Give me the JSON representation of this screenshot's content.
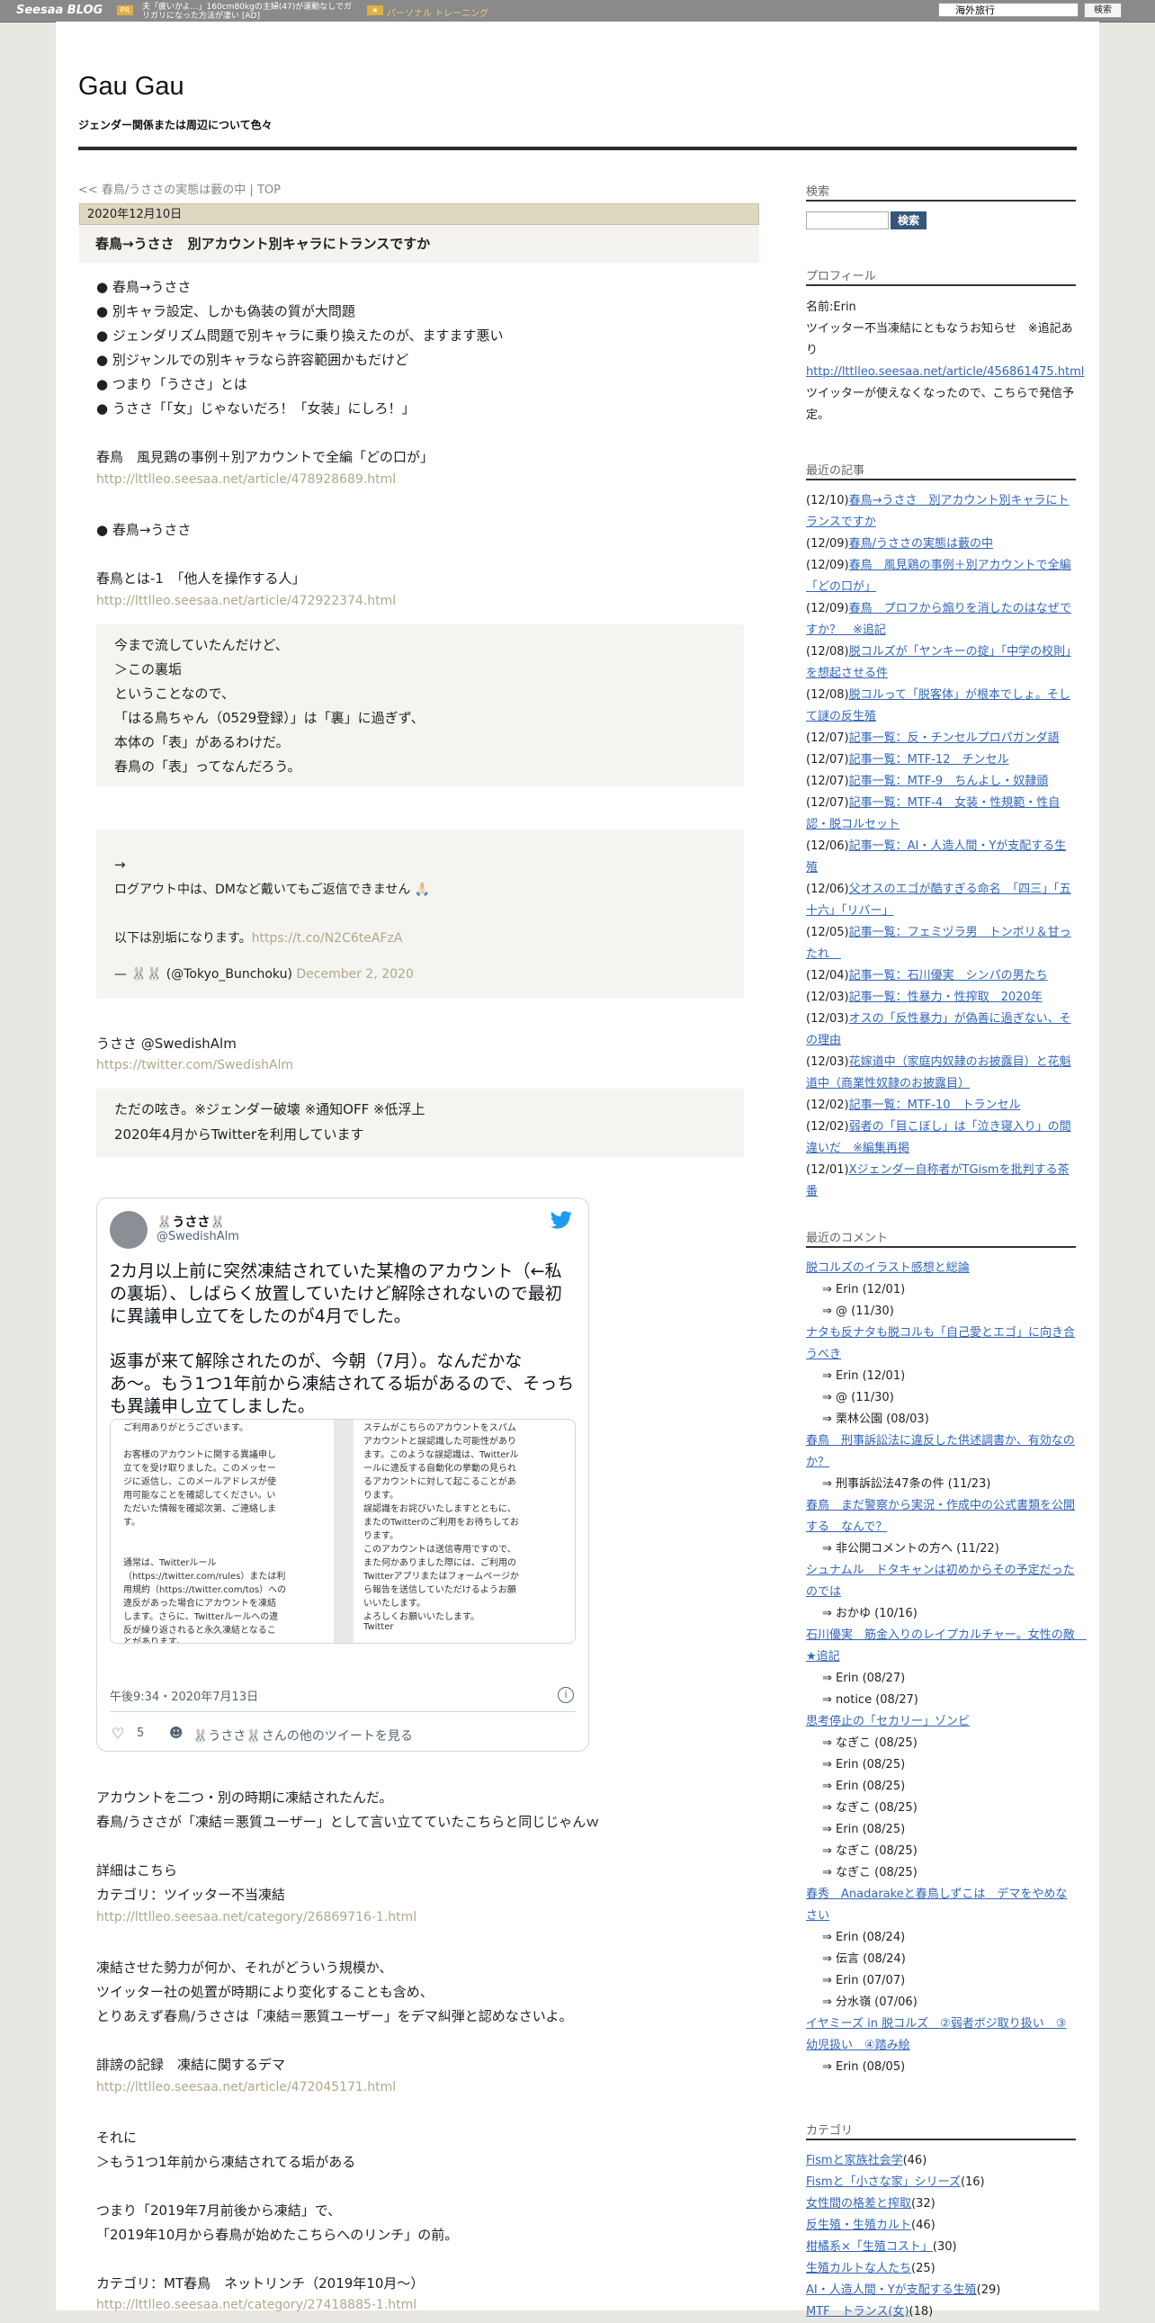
{
  "topbar": {
    "logo": "Seesaa BLOG",
    "ad_badge": "PR",
    "ad_text": "夫「疲いかよ…」160cm80kgの主婦(47)が運動なしでガリガリになった方法が凄い [AD]",
    "ad2_badge": "★",
    "ad2_text": "パーソナル トレーニング",
    "search_value": "海外旅行",
    "search_button": "検索"
  },
  "blog": {
    "title": "Gau Gau",
    "subtitle": "ジェンダー関係または周辺について色々"
  },
  "article": {
    "breadcrumb": "<< 春鳥/うささの実態は藪の中 | TOP",
    "date": "2020年12月10日",
    "title": "春鳥→うささ　別アカウント別キャラにトランスですか",
    "bullets": [
      "● 春鳥→うささ",
      "● 別キャラ設定、しかも偽装の質が大問題",
      "● ジェンダリズム問題で別キャラに乗り換えたのが、ますます悪い",
      "● 別ジャンルでの別キャラなら許容範囲かもだけど",
      "● つまり「うささ」とは",
      "● うささ「「女」じゃないだろ！「女装」にしろ！」"
    ],
    "p1": "春鳥　風見鶏の事例＋別アカウントで全編「どの口が」",
    "link1": "http://lttlleo.seesaa.net/article/478928689.html",
    "p2": "● 春鳥→うささ",
    "p3": "春鳥とは-1　「他人を操作する人」",
    "link2": "http://lttlleo.seesaa.net/article/472922374.html",
    "quote1": [
      "今まで流していたんだけど、",
      "＞この裏垢",
      "ということなので、",
      "「はる鳥ちゃん（0529登録）」は「裏」に過ぎず、",
      "本体の「表」があるわけだ。",
      "春鳥の「表」ってなんだろう。"
    ],
    "quote2_arrow": "→",
    "quote2_line1": "ログアウト中は、DMなど戴いてもご返信できません 🙏🏻",
    "quote2_line2_prefix": "以下は別垢になります。",
    "quote2_link": "https://t.co/N2C6teAFzA",
    "quote2_sig": "— 🐰🐰 (@Tokyo_Bunchoku)",
    "quote2_date": "December 2, 2020",
    "p4": "うささ @SwedishAlm",
    "link3": "https://twitter.com/SwedishAlm",
    "quote3": [
      "ただの呟き。※ジェンダー破壊 ※通知OFF ※低浮上",
      "2020年4月からTwitterを利用しています"
    ],
    "tweet": {
      "name": "🐰うささ🐰",
      "handle": "@SwedishAlm",
      "body": [
        "2カ月以上前に突然凍結されていた某櫓のアカウント（←私",
        "の裏垢）、しばらく放置していたけど解除されないので最初",
        "に異議申し立てをしたのが4月でした。",
        "",
        "返事が来て解除されたのが、今朝（7月）。なんだかな",
        "あ〜。もう1つ1年前から凍結されてる垢があるので、そっち",
        "も異議申し立てしました。"
      ],
      "img_left": [
        "ご利用ありがとうございます。",
        "",
        "お客様のアカウントに関する異議申し",
        "立てを受け取りました。このメッセー",
        "ジに返信し、このメールアドレスが使",
        "用可能なことを確認してください。い",
        "ただいた情報を確認次第、ご連絡しま",
        "す。",
        "",
        "通常は、Twitterルール",
        "（https://twitter.com/rules）または利",
        "用規約（https://twitter.com/tos）への",
        "違反があった場合にアカウントを凍結",
        "します。さらに、Twitterルールへの違",
        "反が繰り返されると永久凍結となるこ",
        "とがあります。"
      ],
      "img_right": [
        "ステムがこちらのアカウントをスパム",
        "アカウントと誤認識した可能性があり",
        "ます。このような誤認識は、Twitterル",
        "ールに違反する自動化の挙動の見られ",
        "るアカウントに対して起こることがあ",
        "ります。",
        "誤認識をお詫びいたしますとともに、",
        "またのTwitterのご利用をお待ちしてお",
        "ります。",
        "このアカウントは送信専用ですので、",
        "また何かありました際には、ご利用の",
        "Twitterアプリまたはフォームページか",
        "ら報告を送信していただけるようお願",
        "いいたします。",
        "よろしくお願いいたします。",
        "Twitter"
      ],
      "time": "午後9:34・2020年7月13日",
      "likes": "5",
      "more": "🐰うささ🐰さんの他のツイートを見る"
    },
    "p5": [
      "アカウントを二つ・別の時期に凍結されたんだ。",
      "春鳥/うささが「凍結＝悪質ユーザー」として言い立てていたこちらと同じじゃんｗ"
    ],
    "p6": [
      "詳細はこちら",
      "カテゴリ：ツイッター不当凍結"
    ],
    "link4": "http://lttlleo.seesaa.net/category/26869716-1.html",
    "p7": [
      "凍結させた勢力が何か、それがどういう規模か、",
      "ツイッター社の処置が時期により変化することも含め、",
      "とりあえず春鳥/うささは「凍結＝悪質ユーザー」をデマ糾弾と認めなさいよ。"
    ],
    "p8": "誹謗の記録　凍結に関するデマ",
    "link5": "http://lttlleo.seesaa.net/article/472045171.html",
    "p9": [
      "それに",
      "＞もう1つ1年前から凍結されてる垢がある"
    ],
    "p10": [
      "つまり「2019年7月前後から凍結」で、",
      "「2019年10月から春鳥が始めたこちらへのリンチ」の前。"
    ],
    "p11": "カテゴリ：MT春鳥　ネットリンチ（2019年10月～）",
    "link6": "http://lttlleo.seesaa.net/category/27418885-1.html"
  },
  "sidebar": {
    "search_heading": "検索",
    "search_button": "検索",
    "profile_heading": "プロフィール",
    "profile_name": "名前:Erin",
    "profile_text1": "ツイッター不当凍結にともなうお知らせ　※追記あり",
    "profile_link": "http://lttlleo.seesaa.net/article/456861475.html",
    "profile_text2": "ツイッターが使えなくなったので、こちらで発信予定。",
    "recent_heading": "最近の記事",
    "recent": [
      {
        "d": "(12/10)",
        "t": "春鳥→うささ　別アカウント別キャラにトランスですか"
      },
      {
        "d": "(12/09)",
        "t": "春鳥/うささの実態は藪の中"
      },
      {
        "d": "(12/09)",
        "t": "春鳥　風見鶏の事例＋別アカウントで全編「どの口が」"
      },
      {
        "d": "(12/09)",
        "t": "春鳥　プロフから煽りを消したのはなぜですか？　※追記"
      },
      {
        "d": "(12/08)",
        "t": "脱コルズが「ヤンキーの掟」「中学の校則」を想起させる件"
      },
      {
        "d": "(12/08)",
        "t": "脱コルって「脱客体」が根本でしょ。そして謎の反生殖"
      },
      {
        "d": "(12/07)",
        "t": "記事一覧：反・チンセルプロパガンダ語"
      },
      {
        "d": "(12/07)",
        "t": "記事一覧：MTF-12　チンセル"
      },
      {
        "d": "(12/07)",
        "t": "記事一覧：MTF-9　ちんよし・奴隷頭"
      },
      {
        "d": "(12/07)",
        "t": "記事一覧：MTF-4　女装・性規範・性自認・脱コルセット"
      },
      {
        "d": "(12/06)",
        "t": "記事一覧：AI・人造人間・Yが支配する生殖"
      },
      {
        "d": "(12/06)",
        "t": "父オスのエゴが酷すぎる命名　「四三」「五十六」「リバー」"
      },
      {
        "d": "(12/05)",
        "t": "記事一覧：フェミヅラ男　トンボリ＆甘ったれ　"
      },
      {
        "d": "(12/04)",
        "t": "記事一覧：石川優実　シンパの男たち"
      },
      {
        "d": "(12/03)",
        "t": "記事一覧：性暴力・性搾取　2020年"
      },
      {
        "d": "(12/03)",
        "t": "オスの「反性暴力」が偽善に過ぎない、その理由"
      },
      {
        "d": "(12/03)",
        "t": "花嫁道中（家庭内奴隷のお披露目）と花魁道中（商業性奴隷のお披露目）"
      },
      {
        "d": "(12/02)",
        "t": "記事一覧：MTF-10　トランセル"
      },
      {
        "d": "(12/02)",
        "t": "弱者の「目こぼし」は「泣き寝入り」の間違いだ　※編集再掲"
      },
      {
        "d": "(12/01)",
        "t": "Xジェンダー自称者がTGismを批判する茶番"
      }
    ],
    "comments_heading": "最近のコメント",
    "comments": [
      {
        "type": "link",
        "t": "脱コルズのイラスト感想と総論"
      },
      {
        "type": "sub",
        "t": "⇒ Erin (12/01)"
      },
      {
        "type": "sub",
        "t": "⇒ @ (11/30)"
      },
      {
        "type": "link",
        "t": "ナタも反ナタも脱コルも「自己愛とエゴ」に向き合うべき"
      },
      {
        "type": "sub",
        "t": "⇒ Erin (12/01)"
      },
      {
        "type": "sub",
        "t": "⇒ @ (11/30)"
      },
      {
        "type": "sub",
        "t": "⇒ 栗林公園 (08/03)"
      },
      {
        "type": "link",
        "t": "春鳥　刑事訴訟法に違反した供述調書か、有効なのか？"
      },
      {
        "type": "sub",
        "t": "⇒ 刑事訴訟法47条の件 (11/23)"
      },
      {
        "type": "link",
        "t": "春鳥　まだ警察から実況・作成中の公式書類を公開する　なんで？"
      },
      {
        "type": "sub",
        "t": "⇒ 非公開コメントの方へ (11/22)"
      },
      {
        "type": "link",
        "t": "シュナムル　ドタキャンは初めからその予定だったのでは"
      },
      {
        "type": "sub",
        "t": "⇒ おかゆ (10/16)"
      },
      {
        "type": "link",
        "t": "石川優実　筋金入りのレイプカルチャー。女性の敵　★追記"
      },
      {
        "type": "sub",
        "t": "⇒ Erin (08/27)"
      },
      {
        "type": "sub",
        "t": "⇒ notice (08/27)"
      },
      {
        "type": "link",
        "t": "思考停止の「セカリー」ゾンビ"
      },
      {
        "type": "sub",
        "t": "⇒ なぎこ (08/25)"
      },
      {
        "type": "sub",
        "t": "⇒ Erin (08/25)"
      },
      {
        "type": "sub",
        "t": "⇒ Erin (08/25)"
      },
      {
        "type": "sub",
        "t": "⇒ なぎこ (08/25)"
      },
      {
        "type": "sub",
        "t": "⇒ Erin (08/25)"
      },
      {
        "type": "sub",
        "t": "⇒ なぎこ (08/25)"
      },
      {
        "type": "sub",
        "t": "⇒ なぎこ (08/25)"
      },
      {
        "type": "link",
        "t": "春秀　Anadarakeと春鳥しずこは　デマをやめなさい"
      },
      {
        "type": "sub",
        "t": "⇒ Erin (08/24)"
      },
      {
        "type": "sub",
        "t": "⇒ 伝言 (08/24)"
      },
      {
        "type": "sub",
        "t": "⇒ Erin (07/07)"
      },
      {
        "type": "sub",
        "t": "⇒ 分水嶺 (07/06)"
      },
      {
        "type": "link",
        "t": "イヤミーズ in 脱コルズ　②弱者ボジ取り扱い　③幼児扱い　④踏み絵"
      },
      {
        "type": "sub",
        "t": "⇒ Erin (08/05)"
      }
    ],
    "category_heading": "カテゴリ",
    "categories": [
      {
        "t": "Fismと家族社会学",
        "n": "(46)"
      },
      {
        "t": "Fismと「小さな家」シリーズ",
        "n": "(16)"
      },
      {
        "t": "女性間の格差と搾取",
        "n": "(32)"
      },
      {
        "t": "反生殖・生殖カルト",
        "n": "(46)"
      },
      {
        "t": "柑橘系×「生殖コスト」",
        "n": "(30)"
      },
      {
        "t": "生殖カルトな人たち",
        "n": "(25)"
      },
      {
        "t": "AI・人造人間・Yが支配する生殖",
        "n": "(29)"
      },
      {
        "t": "MTF　トランス(女)",
        "n": "(18)"
      }
    ]
  }
}
